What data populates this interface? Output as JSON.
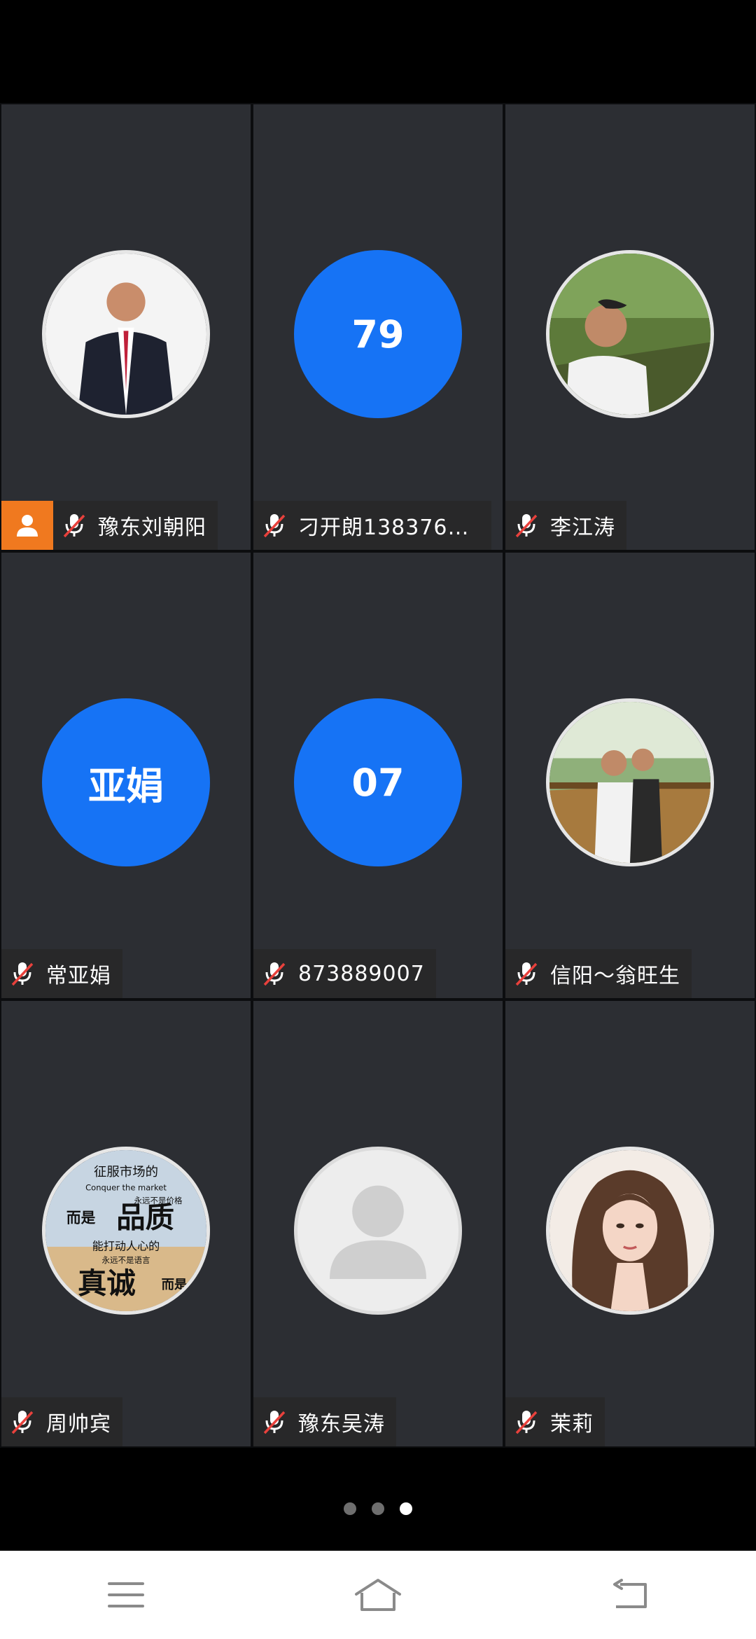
{
  "participants": [
    {
      "name": "豫东刘朝阳",
      "avatar": "photo-man-suit",
      "host": true
    },
    {
      "name": "刁开朗1383761...",
      "avatar_text": "79",
      "avatar": "initials"
    },
    {
      "name": "李江涛",
      "avatar": "photo-man-outdoor"
    },
    {
      "name": "常亚娟",
      "avatar_text": "亚娟",
      "avatar": "initials"
    },
    {
      "name": "873889007",
      "avatar_text": "07",
      "avatar": "initials"
    },
    {
      "name": "信阳～翁旺生",
      "avatar": "photo-two-men-bridge"
    },
    {
      "name": "周帅宾",
      "avatar": "photo-quote-poster",
      "poster_text": [
        "征服市场的",
        "Conquer the market",
        "永远不是价格",
        "而是",
        "品质",
        "能打动人心的",
        "永远不是语言",
        "真诚",
        "而是"
      ]
    },
    {
      "name": "豫东吴涛",
      "avatar": "placeholder-person"
    },
    {
      "name": "茉莉",
      "avatar": "photo-woman"
    }
  ],
  "pager": {
    "total": 3,
    "active": 3
  },
  "colors": {
    "accent": "#1673f5",
    "host_badge": "#f0791f",
    "mic_muted": "#e8413c"
  },
  "navbar": [
    "menu-icon",
    "home-icon",
    "back-icon"
  ]
}
